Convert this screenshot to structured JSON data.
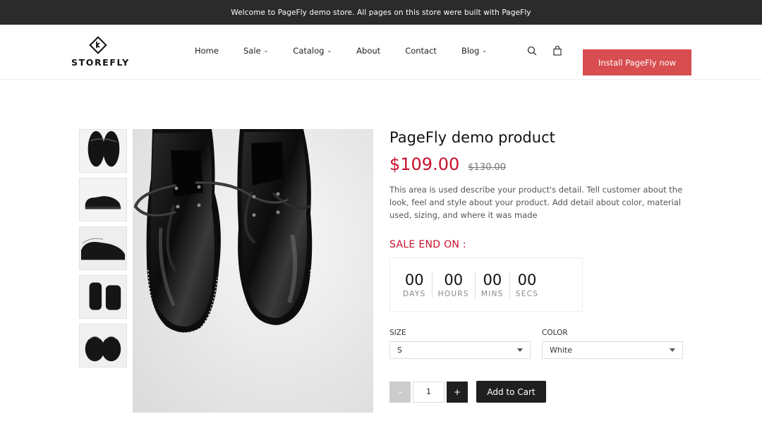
{
  "announcement": "Welcome to PageFly demo store. All pages on this store were built with PageFly",
  "logo": {
    "text": "STOREFLY"
  },
  "nav": [
    {
      "label": "Home",
      "has_dropdown": false
    },
    {
      "label": "Sale",
      "has_dropdown": true
    },
    {
      "label": "Catalog",
      "has_dropdown": true
    },
    {
      "label": "About",
      "has_dropdown": false
    },
    {
      "label": "Contact",
      "has_dropdown": false
    },
    {
      "label": "Blog",
      "has_dropdown": true
    }
  ],
  "header_icons": [
    "search-icon",
    "cart-icon"
  ],
  "install_button": "Install PageFly now",
  "product": {
    "title": "PageFly demo product",
    "price": "$109.00",
    "compare_price": "$130.00",
    "description": "This area is used describe your product's detail. Tell customer about the look, feel and style about your product. Add detail about color, material used, sizing, and where it was made"
  },
  "sale": {
    "label": "SALE END ON :",
    "units": [
      {
        "value": "00",
        "label": "DAYS"
      },
      {
        "value": "00",
        "label": "HOURS"
      },
      {
        "value": "00",
        "label": "MINS"
      },
      {
        "value": "00",
        "label": "SECS"
      }
    ]
  },
  "options": {
    "size": {
      "label": "SIZE",
      "value": "S"
    },
    "color": {
      "label": "COLOR",
      "value": "White"
    }
  },
  "cart": {
    "minus": "-",
    "plus": "+",
    "quantity": "1",
    "add_label": "Add to Cart"
  },
  "colors": {
    "accent": "#c8102e",
    "button": "#d84d4f",
    "dark": "#1f1f1f"
  }
}
